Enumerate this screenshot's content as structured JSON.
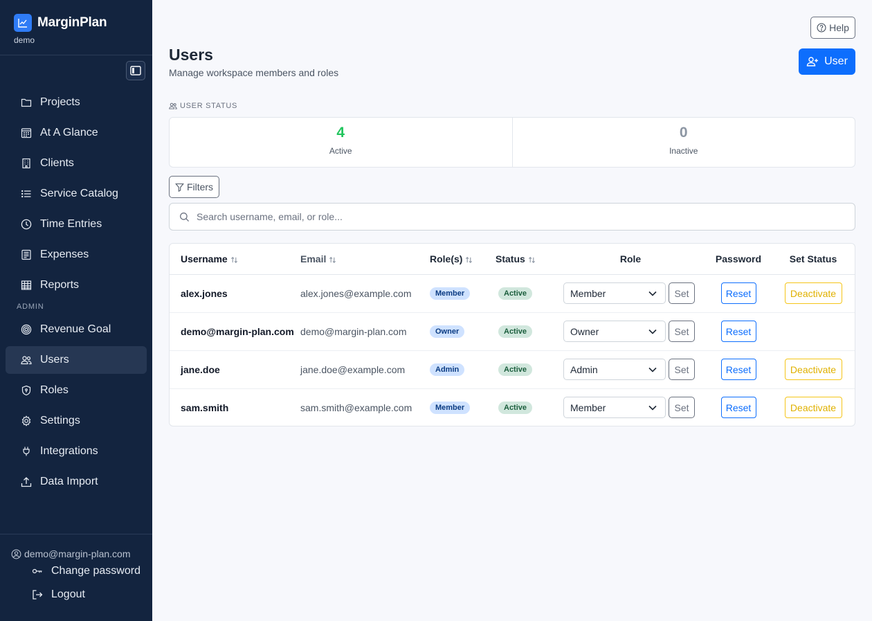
{
  "brand": {
    "name": "MarginPlan",
    "workspace": "demo"
  },
  "nav": {
    "items": [
      {
        "label": "Projects",
        "icon": "folder-icon"
      },
      {
        "label": "At A Glance",
        "icon": "calendar-grid-icon"
      },
      {
        "label": "Clients",
        "icon": "building-icon"
      },
      {
        "label": "Service Catalog",
        "icon": "list-icon"
      },
      {
        "label": "Time Entries",
        "icon": "clock-icon"
      },
      {
        "label": "Expenses",
        "icon": "receipt-icon"
      },
      {
        "label": "Reports",
        "icon": "table-icon"
      }
    ],
    "admin_label": "ADMIN",
    "admin_items": [
      {
        "label": "Revenue Goal",
        "icon": "target-icon"
      },
      {
        "label": "Users",
        "icon": "users-icon",
        "active": true
      },
      {
        "label": "Roles",
        "icon": "shield-icon"
      },
      {
        "label": "Settings",
        "icon": "gear-icon"
      },
      {
        "label": "Integrations",
        "icon": "plug-icon"
      },
      {
        "label": "Data Import",
        "icon": "upload-icon"
      }
    ]
  },
  "footer": {
    "user": "demo@margin-plan.com",
    "change_password": "Change password",
    "logout": "Logout"
  },
  "header": {
    "help": "Help",
    "title": "Users",
    "subtitle": "Manage workspace members and roles",
    "add_user": "User"
  },
  "status": {
    "heading": "USER STATUS",
    "active_count": "4",
    "active_label": "Active",
    "inactive_count": "0",
    "inactive_label": "Inactive",
    "active_color": "#22c55e",
    "inactive_color": "#8c96a3"
  },
  "filters": {
    "label": "Filters"
  },
  "search": {
    "placeholder": "Search username, email, or role...",
    "value": ""
  },
  "table": {
    "columns": {
      "username": "Username",
      "email": "Email",
      "roles": "Role(s)",
      "status": "Status",
      "role": "Role",
      "password": "Password",
      "set_status": "Set Status"
    },
    "set_label": "Set",
    "reset_label": "Reset",
    "deactivate_label": "Deactivate",
    "rows": [
      {
        "username": "alex.jones",
        "email": "alex.jones@example.com",
        "role_badge": "Member",
        "status": "Active",
        "role_select": "Member",
        "can_deactivate": true
      },
      {
        "username": "demo@margin-plan.com",
        "email": "demo@margin-plan.com",
        "role_badge": "Owner",
        "status": "Active",
        "role_select": "Owner",
        "can_deactivate": false
      },
      {
        "username": "jane.doe",
        "email": "jane.doe@example.com",
        "role_badge": "Admin",
        "status": "Active",
        "role_select": "Admin",
        "can_deactivate": true
      },
      {
        "username": "sam.smith",
        "email": "sam.smith@example.com",
        "role_badge": "Member",
        "status": "Active",
        "role_select": "Member",
        "can_deactivate": true
      }
    ]
  }
}
